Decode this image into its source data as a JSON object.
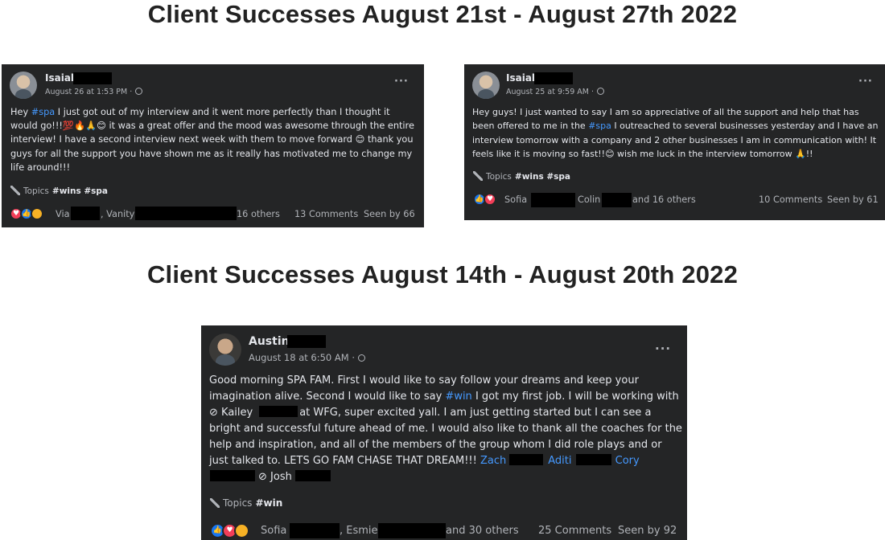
{
  "titles": {
    "week1": "Client Successes August 21st - August 27th 2022",
    "week2": "Client Successes August 14th - August 20th 2022"
  },
  "colors": {
    "card_bg": "#242526",
    "text": "#e4e6eb",
    "muted": "#b0b3b8",
    "link": "#4599ff"
  },
  "posts": [
    {
      "author": "Isaiah",
      "timestamp": "August 26 at 1:53 PM ·",
      "body": {
        "p1": "Hey ",
        "hashtag": "#spa",
        "p2": " I just got out of my interview and it went more perfectly than I thought it would go!!!💯🔥🙏😊 it was a great offer and the mood was awesome through the entire interview! I have a second interview next week with them to move forward 😊 thank you guys for all the support you have shown me as it really has motivated me to change my life around!!!"
      },
      "topics_label": "Topics",
      "topics": "#wins #spa",
      "reactor_1": "Via",
      "reactor_2": ", Vanity",
      "reactor_rest": "16 others",
      "comments": "13 Comments",
      "seen": "Seen by 66"
    },
    {
      "author": "Isaiah",
      "timestamp": "August 25 at 9:59 AM ·",
      "body": {
        "p1": "Hey guys! I just wanted to say I am so appreciative of all the support and help that has been offered to me in the ",
        "hashtag": "#spa",
        "p2": " I outreached to several businesses yesterday and I have an interview tomorrow with a company and 2 other businesses I am in communication with! It feels like it is moving so fast!!😊 wish me luck in the interview tomorrow 🙏!!"
      },
      "topics_label": "Topics",
      "topics": "#wins #spa",
      "reactor_1": "Sofia",
      "reactor_2": "Colin",
      "reactor_rest": "and 16 others",
      "comments": "10 Comments",
      "seen": "Seen by 61"
    },
    {
      "author": "Austin",
      "timestamp": "August 18 at 6:50 AM ·",
      "body": {
        "p1": "Good morning SPA FAM. First I would like to say follow your dreams and keep your imagination alive. Second I would like to say ",
        "hashtag": "#win",
        "p2": " I got my first job. I will be working with ",
        "mention1": "Kailey",
        "p3": "at WFG, super excited yall. I am just getting started but I can see a bright and successful future ahead of me. I would also like to thank all the coaches for the help and inspiration, and all of the members of the group whom I did role plays and or just talked to. LETS GO FAM CHASE THAT DREAM!!! ",
        "mention2": "Zach",
        "mention3": "Aditi",
        "mention4": "Cory",
        "mention5": "Josh"
      },
      "topics_label": "Topics",
      "topics": "#win",
      "reactor_1": "Sofia",
      "reactor_2": ", Esmie",
      "reactor_rest": "and 30 others",
      "comments": "25 Comments",
      "seen": "Seen by 92"
    }
  ],
  "icons": {
    "more": "more-options-icon",
    "globe": "globe-icon",
    "pin": "pin-icon",
    "love": "love-reaction-icon",
    "like": "like-reaction-icon",
    "care": "care-reaction-icon"
  }
}
